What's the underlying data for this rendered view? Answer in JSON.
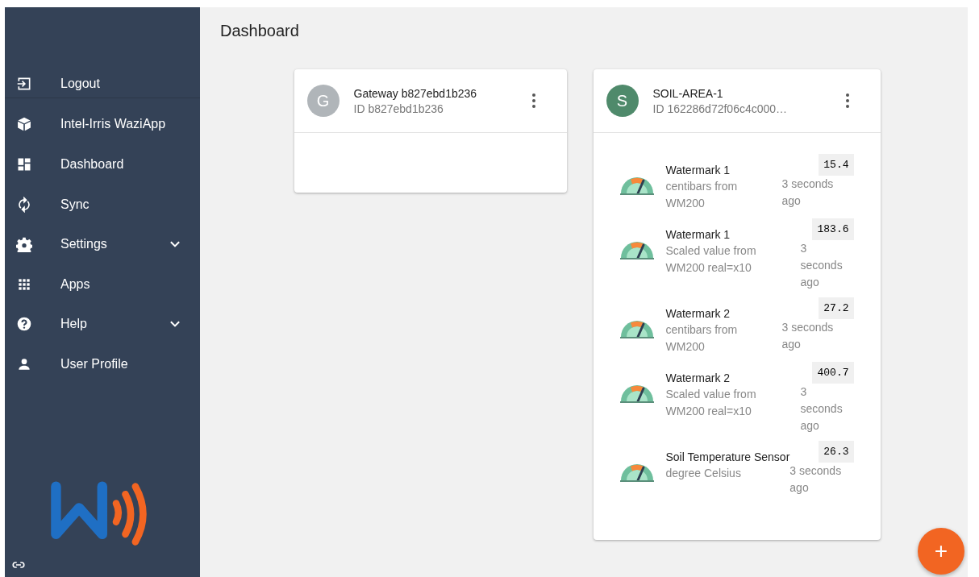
{
  "sidebar": {
    "items": [
      {
        "label": "Logout",
        "expandable": false
      },
      {
        "label": "Intel-Irris WaziApp",
        "expandable": false
      },
      {
        "label": "Dashboard",
        "expandable": false
      },
      {
        "label": "Sync",
        "expandable": false
      },
      {
        "label": "Settings",
        "expandable": true
      },
      {
        "label": "Apps",
        "expandable": false
      },
      {
        "label": "Help",
        "expandable": true
      },
      {
        "label": "User Profile",
        "expandable": false
      }
    ]
  },
  "page_title": "Dashboard",
  "cards": [
    {
      "avatar": "G",
      "color": "#b0b5b9",
      "title": "Gateway b827ebd1b236",
      "subtitle": "ID b827ebd1b236"
    },
    {
      "avatar": "S",
      "color": "#4f8a6b",
      "title": "SOIL-AREA-1",
      "subtitle": "ID 162286d72f06c4c000…",
      "sensors": [
        {
          "name": "Watermark 1",
          "unit": "centibars from WM200",
          "value": "15.4",
          "time": "3 seconds ago"
        },
        {
          "name": "Watermark 1",
          "unit": "Scaled value from WM200 real=x10",
          "value": "183.6",
          "time": "3 seconds ago"
        },
        {
          "name": "Watermark 2",
          "unit": "centibars from WM200",
          "value": "27.2",
          "time": "3 seconds ago"
        },
        {
          "name": "Watermark 2",
          "unit": "Scaled value from WM200 real=x10",
          "value": "400.7",
          "time": "3 seconds ago"
        },
        {
          "name": "Soil Temperature Sensor",
          "unit": "degree Celsius",
          "value": "26.3",
          "time": "3 seconds ago"
        }
      ]
    }
  ],
  "fab": {
    "label": "+"
  }
}
